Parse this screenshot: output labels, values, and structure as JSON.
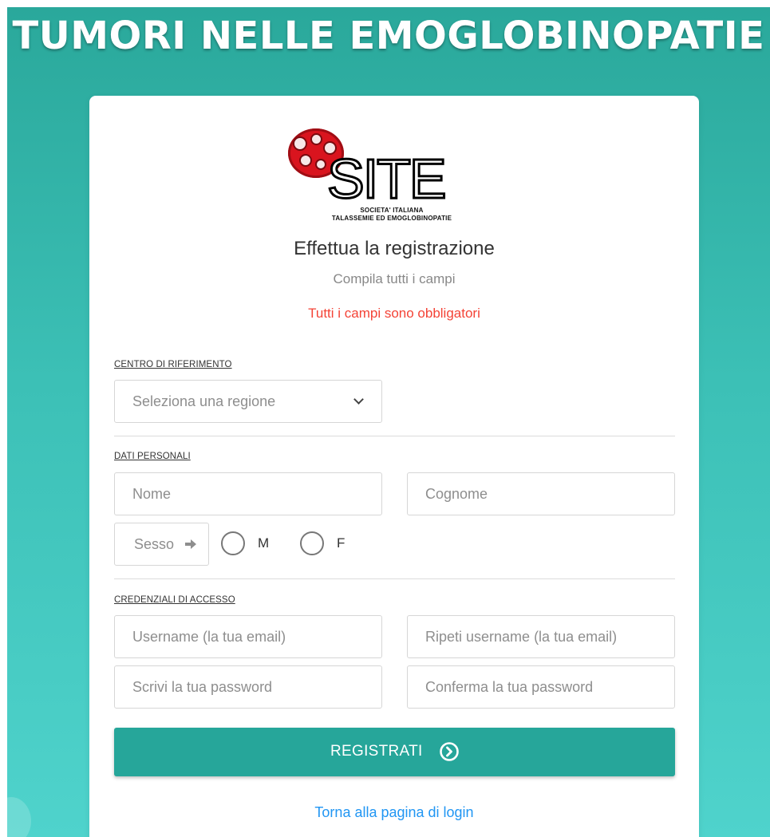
{
  "page": {
    "title": "TUMORI NELLE EMOGLOBINOPATIE"
  },
  "logo": {
    "text": "SITE",
    "subtitle_line1": "SOCIETA' ITALIANA",
    "subtitle_line2": "TALASSEMIE ED EMOGLOBINOPATIE"
  },
  "form": {
    "heading": "Effettua la registrazione",
    "subheading": "Compila tutti i campi",
    "required_note": "Tutti i campi sono obbligatori",
    "sections": {
      "reference_center": {
        "label": "CENTRO DI RIFERIMENTO",
        "region_select": {
          "placeholder": "Seleziona una regione",
          "icon": "chevron-down-icon"
        }
      },
      "personal_data": {
        "label": "DATI PERSONALI",
        "first_name_placeholder": "Nome",
        "last_name_placeholder": "Cognome",
        "sex_label": "Sesso",
        "sex_icon": "arrow-right-icon",
        "sex_options": [
          "M",
          "F"
        ]
      },
      "credentials": {
        "label": "CREDENZIALI DI ACCESSO",
        "username_placeholder": "Username (la tua email)",
        "repeat_username_placeholder": "Ripeti username (la tua email)",
        "password_placeholder": "Scrivi la tua password",
        "confirm_password_placeholder": "Conferma la tua password"
      }
    },
    "submit": {
      "label": "REGISTRATI",
      "icon": "chevron-circle-right-icon"
    },
    "back_link": "Torna alla pagina di login"
  },
  "colors": {
    "background_top": "#2aa89b",
    "background_bottom": "#4fd3cc",
    "button": "#26a69a",
    "required_text": "#f44336",
    "link": "#2196f3",
    "logo_red": "#d9141e"
  }
}
